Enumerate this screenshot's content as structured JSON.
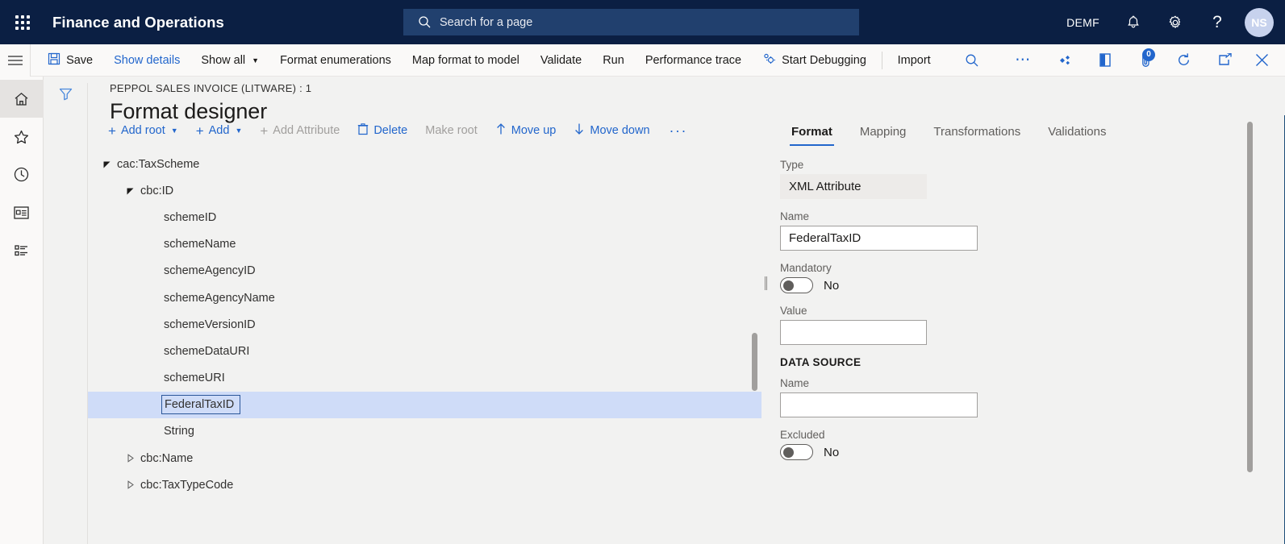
{
  "topbar": {
    "waffle_icon": "app-launcher-icon",
    "app_title": "Finance and Operations",
    "search_placeholder": "Search for a page",
    "search_icon": "search-icon",
    "company": "DEMF",
    "icons": [
      "notification-bell-icon",
      "settings-gear-icon",
      "help-question-icon"
    ],
    "avatar_initials": "NS",
    "bg_color": "#0b1f43",
    "search_bg": "#21406e"
  },
  "commandbar": {
    "hamburger_icon": "hamburger-menu-icon",
    "save_label": "Save",
    "save_icon": "save-disk-icon",
    "items": [
      {
        "label": "Show details",
        "type": "link"
      },
      {
        "label": "Show all",
        "type": "dropdown"
      },
      {
        "label": "Format enumerations",
        "type": "plain"
      },
      {
        "label": "Map format to model",
        "type": "plain"
      },
      {
        "label": "Validate",
        "type": "plain"
      },
      {
        "label": "Run",
        "type": "plain"
      },
      {
        "label": "Performance trace",
        "type": "plain"
      },
      {
        "label": "Start Debugging",
        "type": "icon-plain",
        "icon": "debug-icon"
      },
      {
        "label": "Import",
        "type": "plain"
      }
    ],
    "right_icons": [
      "search-icon",
      "overflow-ellipsis-icon",
      "office-apps-icon",
      "open-in-office-icon",
      "attachments-icon",
      "refresh-icon",
      "popout-icon",
      "close-icon"
    ],
    "attachment_badge": "0"
  },
  "navrail": {
    "items": [
      {
        "name": "home-icon",
        "active": true
      },
      {
        "name": "favorites-star-icon",
        "active": false
      },
      {
        "name": "recent-clock-icon",
        "active": false
      },
      {
        "name": "workspaces-icon",
        "active": false
      },
      {
        "name": "modules-list-icon",
        "active": false
      }
    ]
  },
  "page": {
    "filter_icon": "filter-funnel-icon",
    "breadcrumb": "PEPPOL SALES INVOICE (LITWARE) : 1",
    "title": "Format designer"
  },
  "actionbar": {
    "items": [
      {
        "label": "Add root",
        "icon": "plus-icon",
        "dropdown": true,
        "disabled": false
      },
      {
        "label": "Add",
        "icon": "plus-icon",
        "dropdown": true,
        "disabled": false
      },
      {
        "label": "Add Attribute",
        "icon": "plus-icon",
        "dropdown": false,
        "disabled": true
      },
      {
        "label": "Delete",
        "icon": "trash-icon",
        "dropdown": false,
        "disabled": false
      },
      {
        "label": "Make root",
        "icon": "",
        "dropdown": false,
        "disabled": true
      },
      {
        "label": "Move up",
        "icon": "arrow-up-icon",
        "dropdown": false,
        "disabled": false
      },
      {
        "label": "Move down",
        "icon": "arrow-down-icon",
        "dropdown": false,
        "disabled": false
      },
      {
        "label": "···",
        "icon": "",
        "dropdown": false,
        "disabled": false
      }
    ]
  },
  "tree": {
    "rows": [
      {
        "label": "cac:TaxScheme",
        "indent": 0,
        "state": "expanded",
        "selected": false,
        "editing": false
      },
      {
        "label": "cbc:ID",
        "indent": 1,
        "state": "expanded",
        "selected": false,
        "editing": false
      },
      {
        "label": "schemeID",
        "indent": 2,
        "state": "leaf",
        "selected": false,
        "editing": false
      },
      {
        "label": "schemeName",
        "indent": 2,
        "state": "leaf",
        "selected": false,
        "editing": false
      },
      {
        "label": "schemeAgencyID",
        "indent": 2,
        "state": "leaf",
        "selected": false,
        "editing": false
      },
      {
        "label": "schemeAgencyName",
        "indent": 2,
        "state": "leaf",
        "selected": false,
        "editing": false
      },
      {
        "label": "schemeVersionID",
        "indent": 2,
        "state": "leaf",
        "selected": false,
        "editing": false
      },
      {
        "label": "schemeDataURI",
        "indent": 2,
        "state": "leaf",
        "selected": false,
        "editing": false
      },
      {
        "label": "schemeURI",
        "indent": 2,
        "state": "leaf",
        "selected": false,
        "editing": false
      },
      {
        "label": "FederalTaxID",
        "indent": 2,
        "state": "leaf",
        "selected": true,
        "editing": true
      },
      {
        "label": "String",
        "indent": 2,
        "state": "leaf",
        "selected": false,
        "editing": false
      },
      {
        "label": "cbc:Name",
        "indent": 1,
        "state": "collapsed",
        "selected": false,
        "editing": false
      },
      {
        "label": "cbc:TaxTypeCode",
        "indent": 1,
        "state": "collapsed",
        "selected": false,
        "editing": false
      }
    ]
  },
  "details": {
    "tabs": [
      {
        "label": "Format",
        "active": true
      },
      {
        "label": "Mapping",
        "active": false
      },
      {
        "label": "Transformations",
        "active": false
      },
      {
        "label": "Validations",
        "active": false
      }
    ],
    "type_label": "Type",
    "type_value": "XML Attribute",
    "name_label": "Name",
    "name_value": "FederalTaxID",
    "mandatory_label": "Mandatory",
    "mandatory_value": "No",
    "value_label": "Value",
    "value_value": "",
    "datasource_header": "DATA SOURCE",
    "ds_name_label": "Name",
    "ds_name_value": "",
    "excluded_label": "Excluded",
    "excluded_value": "No"
  }
}
